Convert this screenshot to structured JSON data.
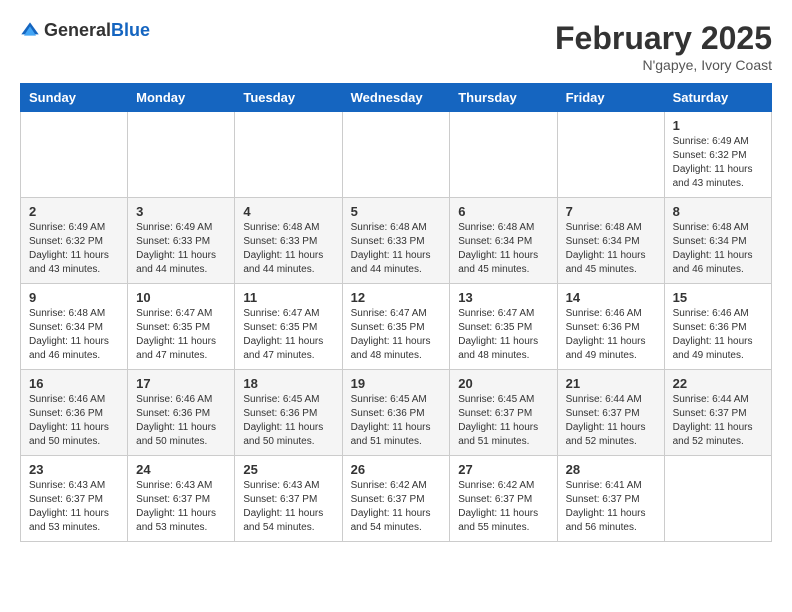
{
  "header": {
    "logo_general": "General",
    "logo_blue": "Blue",
    "month_year": "February 2025",
    "location": "N'gapye, Ivory Coast"
  },
  "days_of_week": [
    "Sunday",
    "Monday",
    "Tuesday",
    "Wednesday",
    "Thursday",
    "Friday",
    "Saturday"
  ],
  "weeks": [
    [
      {
        "day": "",
        "info": ""
      },
      {
        "day": "",
        "info": ""
      },
      {
        "day": "",
        "info": ""
      },
      {
        "day": "",
        "info": ""
      },
      {
        "day": "",
        "info": ""
      },
      {
        "day": "",
        "info": ""
      },
      {
        "day": "1",
        "info": "Sunrise: 6:49 AM\nSunset: 6:32 PM\nDaylight: 11 hours and 43 minutes."
      }
    ],
    [
      {
        "day": "2",
        "info": "Sunrise: 6:49 AM\nSunset: 6:32 PM\nDaylight: 11 hours and 43 minutes."
      },
      {
        "day": "3",
        "info": "Sunrise: 6:49 AM\nSunset: 6:33 PM\nDaylight: 11 hours and 44 minutes."
      },
      {
        "day": "4",
        "info": "Sunrise: 6:48 AM\nSunset: 6:33 PM\nDaylight: 11 hours and 44 minutes."
      },
      {
        "day": "5",
        "info": "Sunrise: 6:48 AM\nSunset: 6:33 PM\nDaylight: 11 hours and 44 minutes."
      },
      {
        "day": "6",
        "info": "Sunrise: 6:48 AM\nSunset: 6:34 PM\nDaylight: 11 hours and 45 minutes."
      },
      {
        "day": "7",
        "info": "Sunrise: 6:48 AM\nSunset: 6:34 PM\nDaylight: 11 hours and 45 minutes."
      },
      {
        "day": "8",
        "info": "Sunrise: 6:48 AM\nSunset: 6:34 PM\nDaylight: 11 hours and 46 minutes."
      }
    ],
    [
      {
        "day": "9",
        "info": "Sunrise: 6:48 AM\nSunset: 6:34 PM\nDaylight: 11 hours and 46 minutes."
      },
      {
        "day": "10",
        "info": "Sunrise: 6:47 AM\nSunset: 6:35 PM\nDaylight: 11 hours and 47 minutes."
      },
      {
        "day": "11",
        "info": "Sunrise: 6:47 AM\nSunset: 6:35 PM\nDaylight: 11 hours and 47 minutes."
      },
      {
        "day": "12",
        "info": "Sunrise: 6:47 AM\nSunset: 6:35 PM\nDaylight: 11 hours and 48 minutes."
      },
      {
        "day": "13",
        "info": "Sunrise: 6:47 AM\nSunset: 6:35 PM\nDaylight: 11 hours and 48 minutes."
      },
      {
        "day": "14",
        "info": "Sunrise: 6:46 AM\nSunset: 6:36 PM\nDaylight: 11 hours and 49 minutes."
      },
      {
        "day": "15",
        "info": "Sunrise: 6:46 AM\nSunset: 6:36 PM\nDaylight: 11 hours and 49 minutes."
      }
    ],
    [
      {
        "day": "16",
        "info": "Sunrise: 6:46 AM\nSunset: 6:36 PM\nDaylight: 11 hours and 50 minutes."
      },
      {
        "day": "17",
        "info": "Sunrise: 6:46 AM\nSunset: 6:36 PM\nDaylight: 11 hours and 50 minutes."
      },
      {
        "day": "18",
        "info": "Sunrise: 6:45 AM\nSunset: 6:36 PM\nDaylight: 11 hours and 50 minutes."
      },
      {
        "day": "19",
        "info": "Sunrise: 6:45 AM\nSunset: 6:36 PM\nDaylight: 11 hours and 51 minutes."
      },
      {
        "day": "20",
        "info": "Sunrise: 6:45 AM\nSunset: 6:37 PM\nDaylight: 11 hours and 51 minutes."
      },
      {
        "day": "21",
        "info": "Sunrise: 6:44 AM\nSunset: 6:37 PM\nDaylight: 11 hours and 52 minutes."
      },
      {
        "day": "22",
        "info": "Sunrise: 6:44 AM\nSunset: 6:37 PM\nDaylight: 11 hours and 52 minutes."
      }
    ],
    [
      {
        "day": "23",
        "info": "Sunrise: 6:43 AM\nSunset: 6:37 PM\nDaylight: 11 hours and 53 minutes."
      },
      {
        "day": "24",
        "info": "Sunrise: 6:43 AM\nSunset: 6:37 PM\nDaylight: 11 hours and 53 minutes."
      },
      {
        "day": "25",
        "info": "Sunrise: 6:43 AM\nSunset: 6:37 PM\nDaylight: 11 hours and 54 minutes."
      },
      {
        "day": "26",
        "info": "Sunrise: 6:42 AM\nSunset: 6:37 PM\nDaylight: 11 hours and 54 minutes."
      },
      {
        "day": "27",
        "info": "Sunrise: 6:42 AM\nSunset: 6:37 PM\nDaylight: 11 hours and 55 minutes."
      },
      {
        "day": "28",
        "info": "Sunrise: 6:41 AM\nSunset: 6:37 PM\nDaylight: 11 hours and 56 minutes."
      },
      {
        "day": "",
        "info": ""
      }
    ]
  ]
}
